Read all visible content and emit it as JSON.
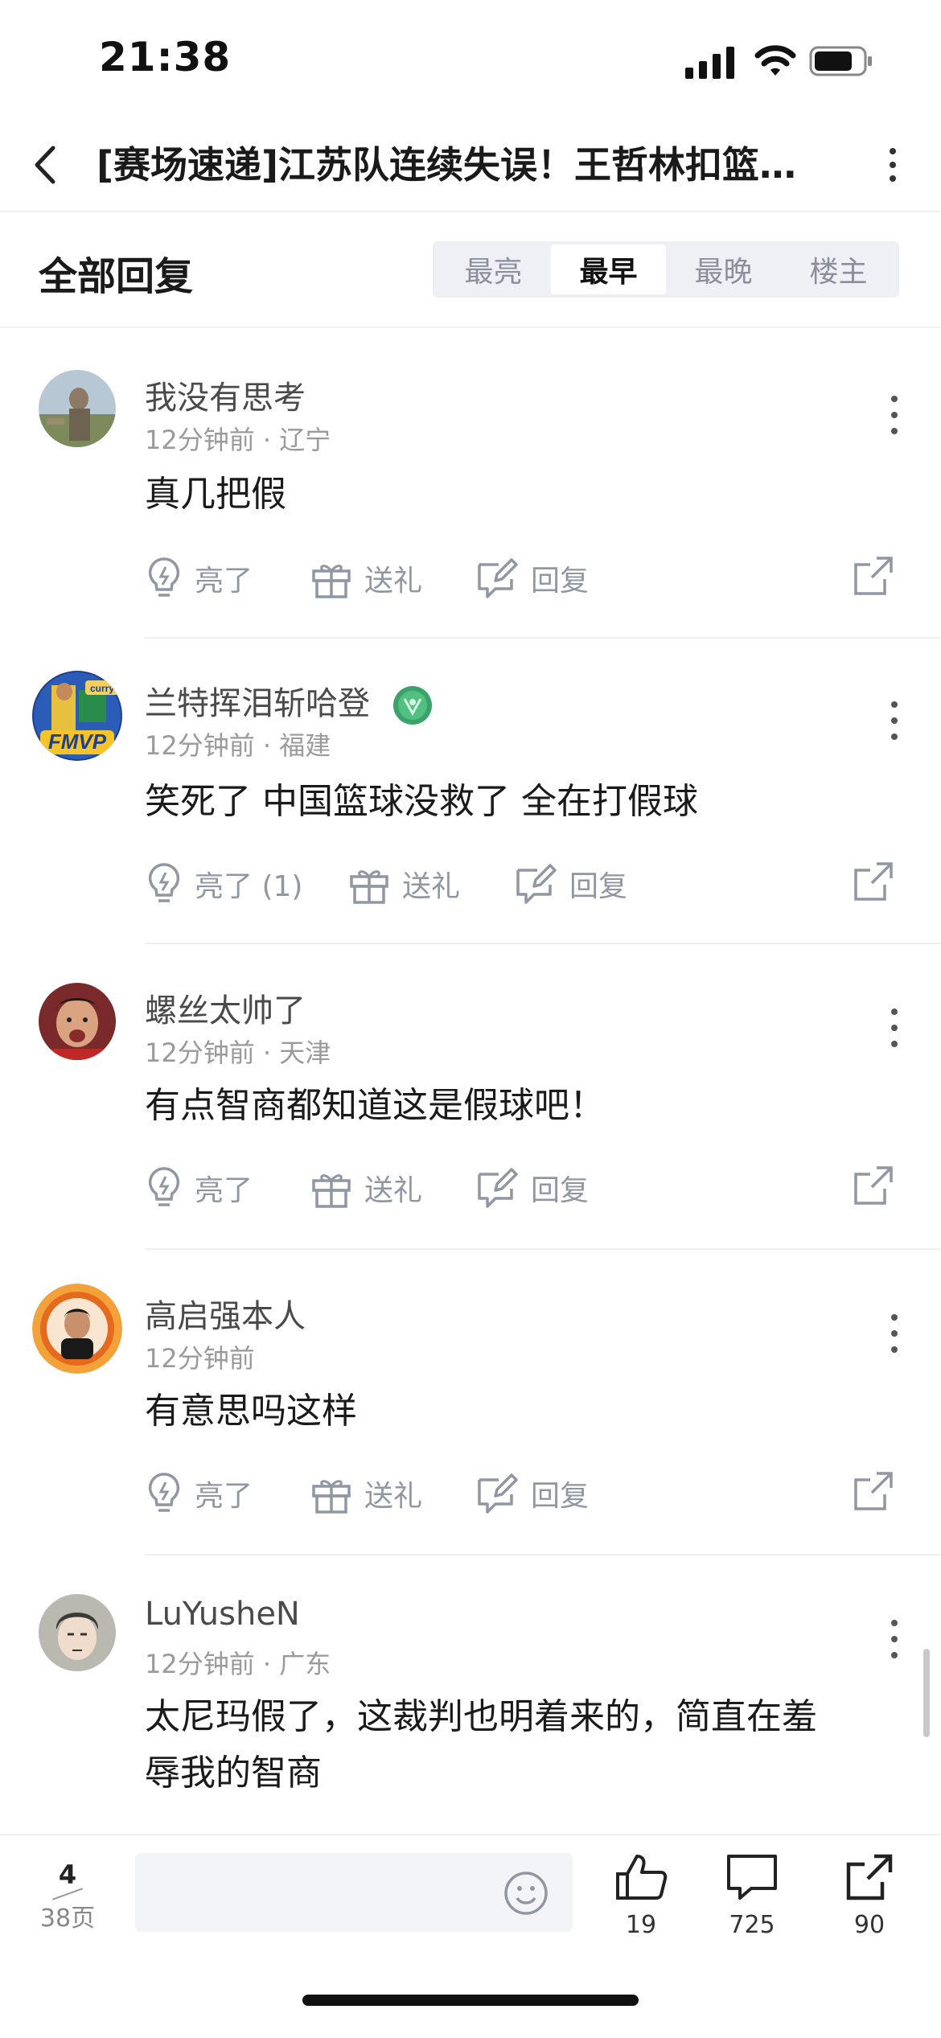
{
  "status_bar": {
    "time": "21:38"
  },
  "nav": {
    "title": "[赛场速递]江苏队连续失误！王哲林扣篮…"
  },
  "reply_header": {
    "label": "全部回复",
    "sort_options": [
      "最亮",
      "最早",
      "最晚",
      "楼主"
    ],
    "active_option": "最早"
  },
  "comments": [
    {
      "name": "我没有思考",
      "time": "12分钟前",
      "region": "辽宁",
      "meta": "12分钟前 · 辽宁",
      "text": "真几把假",
      "like_label": "亮了",
      "gift_label": "送礼",
      "reply_label": "回复"
    },
    {
      "name": "兰特挥泪斩哈登",
      "time": "12分钟前",
      "region": "福建",
      "meta": "12分钟前 · 福建",
      "text": "笑死了 中国篮球没救了 全在打假球",
      "like_label": "亮了 (1)",
      "gift_label": "送礼",
      "reply_label": "回复"
    },
    {
      "name": "螺丝太帅了",
      "time": "12分钟前",
      "region": "天津",
      "meta": "12分钟前 · 天津",
      "text": "有点智商都知道这是假球吧！",
      "like_label": "亮了",
      "gift_label": "送礼",
      "reply_label": "回复"
    },
    {
      "name": "高启强本人",
      "time": "12分钟前",
      "meta": "12分钟前",
      "text": "有意思吗这样",
      "like_label": "亮了",
      "gift_label": "送礼",
      "reply_label": "回复"
    },
    {
      "name": "LuYusheN",
      "time": "12分钟前",
      "region": "广东",
      "meta": "12分钟前 · 广东",
      "text_line1": "太尼玛假了，这裁判也明着来的，简直在羞",
      "text_line2": "辱我的智商"
    }
  ],
  "avatar_text": {
    "c2_badge_top": "curry",
    "c2_badge_bottom": "FMVP"
  },
  "bottom_bar": {
    "current_page": "4",
    "total_pages": "38页",
    "input_placeholder": "",
    "like_count": "19",
    "comment_count": "725",
    "share_count": "90"
  },
  "colors": {
    "accent_gray": "#9097a2",
    "segment_bg": "#eef0f6",
    "text_dark": "#1a1a1a"
  },
  "icons": [
    "signal-icon",
    "wifi-icon",
    "battery-icon",
    "back-icon",
    "more-icon",
    "lightbulb-icon",
    "gift-icon",
    "reply-icon",
    "share-icon",
    "smile-icon",
    "thumbs-up-icon",
    "comment-icon"
  ]
}
